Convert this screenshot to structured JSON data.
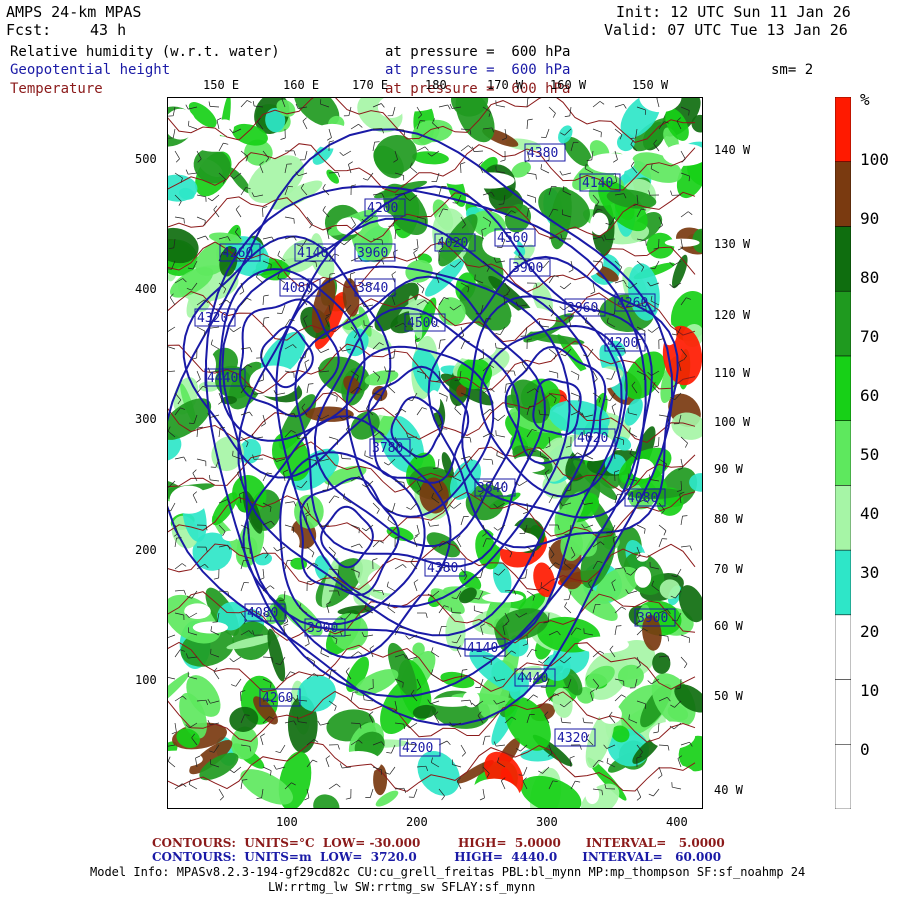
{
  "header": {
    "model": "AMPS 24-km MPAS",
    "init": "Init: 12 UTC Sun 11 Jan 26",
    "fcst_label": "Fcst:",
    "fcst_value": "43 h",
    "valid": "Valid: 07 UTC Tue 13 Jan 26",
    "rh_label": "Relative humidity (w.r.t. water)",
    "gh_label": "Geopotential height",
    "temp_label": "Temperature",
    "pressure_text": "at pressure =  600 hPa",
    "smoothing": "sm= 2"
  },
  "lon_labels_top": [
    "150 E",
    "160 E",
    "170 E",
    "180",
    "170 W",
    "160 W",
    "150 W"
  ],
  "lon_labels_right": [
    "140 W",
    "130 W",
    "120 W",
    "110 W",
    "100 W",
    "90 W",
    "80 W",
    "70 W",
    "60 W",
    "50 W",
    "40 W"
  ],
  "y_ticks": [
    "500",
    "400",
    "300",
    "200",
    "100"
  ],
  "x_ticks": [
    "100",
    "200",
    "300",
    "400"
  ],
  "colorbar": {
    "unit": "%",
    "levels": [
      "0",
      "10",
      "20",
      "30",
      "40",
      "50",
      "60",
      "70",
      "80",
      "90",
      "100"
    ],
    "colors": [
      "#ffffff",
      "#ffffff",
      "#ffffff",
      "#2ee6c8",
      "#a6f5a6",
      "#5ee85e",
      "#17d017",
      "#1f9a1f",
      "#0f6e0f",
      "#7a3a10",
      "#ff1a00"
    ]
  },
  "contour_labels": [
    "4380",
    "4200",
    "3900",
    "4260",
    "4140",
    "3960",
    "4080",
    "4020",
    "3840",
    "4320",
    "3780",
    "4440",
    "4500",
    "4560",
    "4140",
    "4260",
    "4200",
    "4080",
    "3900",
    "4320",
    "4380",
    "4440",
    "4020",
    "3960",
    "3840",
    "4200",
    "4080",
    "3900",
    "4260",
    "4140"
  ],
  "footer": {
    "temp_line": "CONTOURS:  UNITS=°C  LOW= -30.000         HIGH=  5.0000      INTERVAL=   5.0000",
    "gh_line": "CONTOURS:  UNITS=m  LOW=  3720.0         HIGH=  4440.0      INTERVAL=   60.000",
    "model_info": "Model Info: MPASv8.2.3-194-gf29cd82c CU:cu_grell_freitas PBL:bl_mynn MP:mp_thompson SF:sf_noahmp 24",
    "model_info2": "LW:rrtmg_lw SW:rrtmg_sw SFLAY:sf_mynn"
  }
}
